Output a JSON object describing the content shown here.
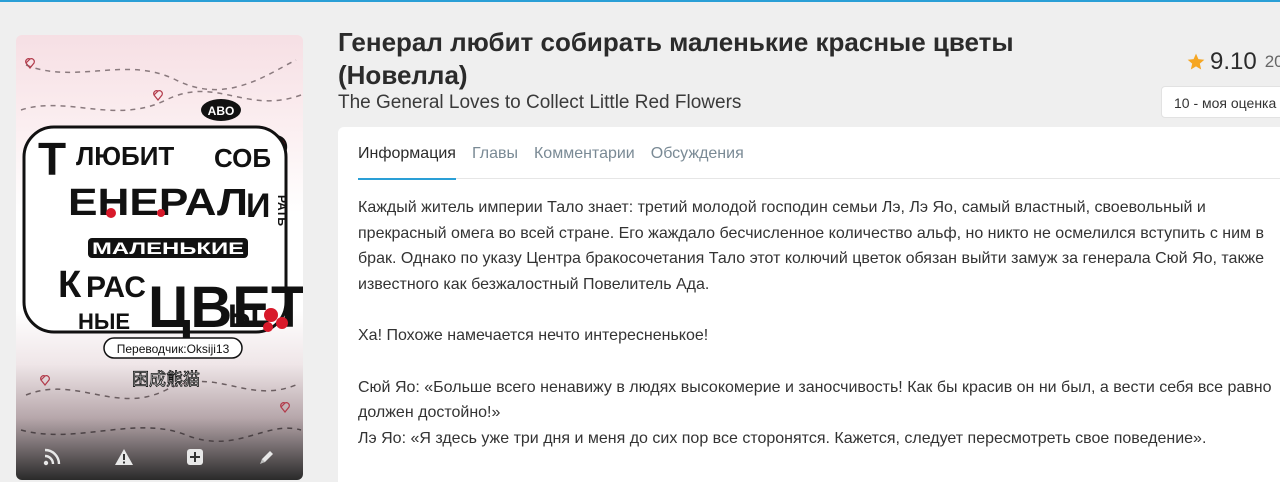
{
  "novel": {
    "title": "Генерал любит собирать маленькие красные цветы (Новелла)",
    "alt_title": "The General Loves to Collect Little Red Flowers"
  },
  "cover": {
    "tag": "ABO",
    "art_words": [
      "Т",
      "ЛЮБИТ",
      "СОБ",
      "ЕНЕРАЛ",
      "И",
      "РАТЬ",
      "МАЛЕНЬКИЕ",
      "К",
      "РАС",
      "ЦВЕТ",
      "НЫЕ",
      "Ы"
    ],
    "translator": "Переводчик:Oksiji13",
    "chinese": "困成熊猫",
    "actions": [
      {
        "name": "rss-icon"
      },
      {
        "name": "warning-icon"
      },
      {
        "name": "add-icon"
      },
      {
        "name": "edit-icon"
      }
    ]
  },
  "rating": {
    "value": "9.10",
    "extra": "20",
    "my_rating": "10 - моя оценка"
  },
  "tabs": [
    {
      "label": "Информация",
      "active": true
    },
    {
      "label": "Главы",
      "active": false
    },
    {
      "label": "Комментарии",
      "active": false
    },
    {
      "label": "Обсуждения",
      "active": false
    }
  ],
  "description": {
    "p1": "Каждый житель империи Тало знает: третий молодой господин семьи Лэ, Лэ Яо, самый властный, своевольный и прекрасный омега во всей стране. Его жаждало бесчисленное количество альф, но никто не осмелился вступить с ним в брак. Однако по указу Центра бракосочетания Тало этот колючий цветок обязан выйти замуж за генерала Сюй Яо, также известного как безжалостный Повелитель Ада.",
    "p2": "Ха! Похоже намечается нечто интересненькое!",
    "p3": "Сюй Яо: «Больше всего ненавижу в людях высокомерие и заносчивость! Как бы красив он ни был, а вести себя все равно должен достойно!»",
    "p4": "Лэ Яо: «Я здесь уже три дня и меня до сих пор все сторонятся. Кажется, следует пересмотреть свое поведение»."
  },
  "colors": {
    "accent": "#2a9fd6",
    "star": "#f5a623",
    "heart": "#e0192a"
  }
}
